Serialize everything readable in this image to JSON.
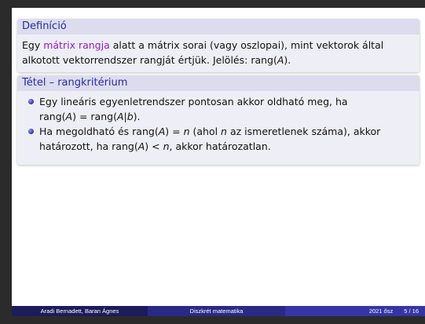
{
  "definition": {
    "title": "Definíció",
    "lines": [
      {
        "pre": "Egy ",
        "accent": "mátrix rangja",
        "post": " alatt a mátrix sorai (vagy oszlopai), mint vektorok által"
      },
      {
        "pre": "alkotott vektorrendszer rangját értjük. Jelölés: rang(",
        "math": "A",
        "post": ")."
      }
    ]
  },
  "theorem": {
    "title": "Tétel – rangkritérium",
    "items": [
      {
        "line1": "Egy lineáris egyenletrendszer pontosan akkor oldható meg, ha",
        "line2_a": "rang(",
        "line2_m1": "A",
        "line2_b": ") = rang(",
        "line2_m2": "A|b",
        "line2_c": ")."
      },
      {
        "line1_a": "Ha megoldható és rang(",
        "line1_m1": "A",
        "line1_b": ") = ",
        "line1_m2": "n",
        "line1_c": " (ahol ",
        "line1_m3": "n",
        "line1_d": " az ismeretlenek száma), akkor",
        "line2_a": "határozott, ha rang(",
        "line2_m1": "A",
        "line2_b": ") < ",
        "line2_m2": "n",
        "line2_c": ", akkor határozatlan."
      }
    ]
  },
  "footer": {
    "authors": "Aradi Bernadett, Baran Ágnes",
    "course": "Diszkrét matematika",
    "term": "2021 ősz",
    "page": "5 / 16"
  },
  "colors": {
    "block_title_text": "#2b2b9a",
    "accent": "#8f1fb3",
    "footer_dark": "#1c1c5c",
    "footer_mid": "#2a2a86",
    "footer_light": "#3535a6"
  }
}
